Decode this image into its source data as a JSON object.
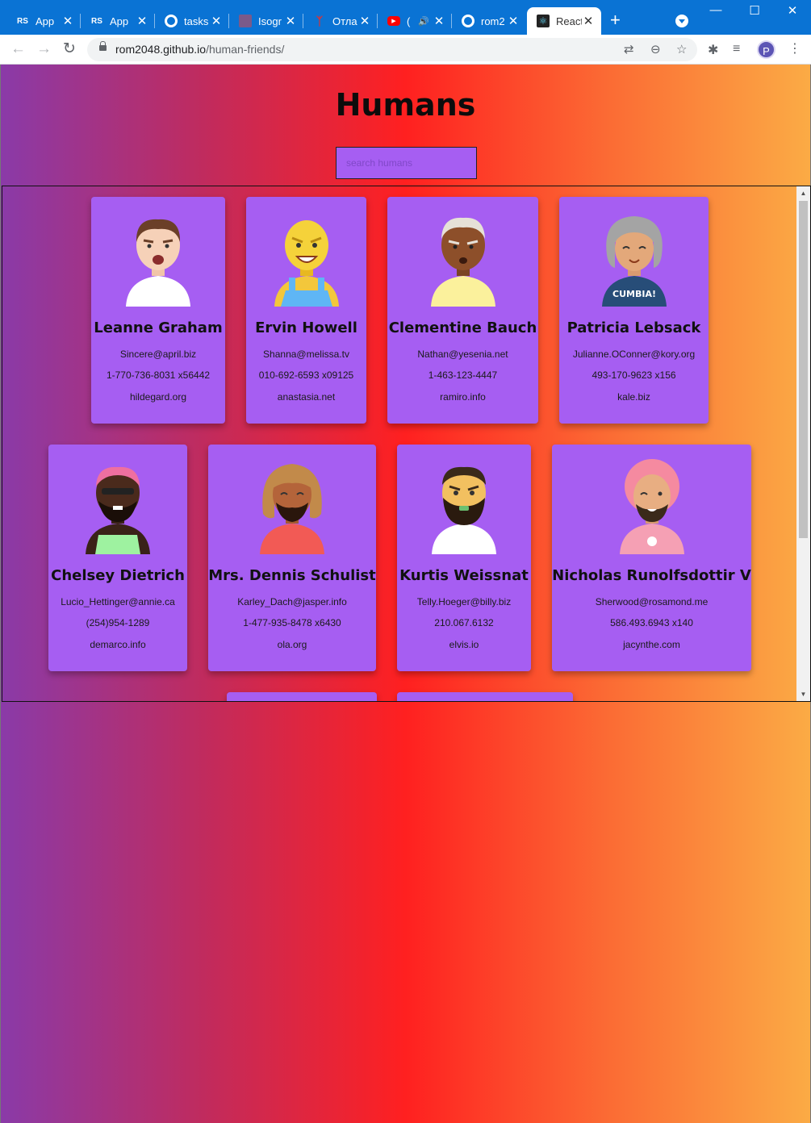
{
  "browser": {
    "tabs": [
      {
        "title": "App",
        "favicon": "RS",
        "favicon_bg": "#ffffff",
        "favicon_fg": "#222222"
      },
      {
        "title": "App",
        "favicon": "RS",
        "favicon_bg": "#ffffff",
        "favicon_fg": "#222222"
      },
      {
        "title": "tasks",
        "favicon": "github-icon",
        "favicon_bg": "#ffffff",
        "favicon_fg": "#000000"
      },
      {
        "title": "Isogr",
        "favicon": "isograph-icon",
        "favicon_bg": "#7a5a8a",
        "favicon_fg": "#ffffff"
      },
      {
        "title": "Отла",
        "favicon": "debug-icon",
        "favicon_bg": "#0a73d4",
        "favicon_fg": "#e03030"
      },
      {
        "title": "(",
        "favicon": "youtube-icon",
        "favicon_bg": "#ff0000",
        "favicon_fg": "#ffffff"
      },
      {
        "title": "rom2",
        "favicon": "github-icon",
        "favicon_bg": "#ffffff",
        "favicon_fg": "#000000"
      },
      {
        "title": "React",
        "favicon": "react-icon",
        "favicon_bg": "#222222",
        "favicon_fg": "#61dafb"
      }
    ],
    "url_host": "rom2048.github.io",
    "url_path": "/human-friends/"
  },
  "page": {
    "title": "Humans",
    "search_placeholder": "search humans"
  },
  "humans": [
    {
      "name": "Leanne Graham",
      "email": "Sincere@april.biz",
      "phone": "1-770-736-8031 x56442",
      "website": "hildegard.org"
    },
    {
      "name": "Ervin Howell",
      "email": "Shanna@melissa.tv",
      "phone": "010-692-6593 x09125",
      "website": "anastasia.net"
    },
    {
      "name": "Clementine Bauch",
      "email": "Nathan@yesenia.net",
      "phone": "1-463-123-4447",
      "website": "ramiro.info"
    },
    {
      "name": "Patricia Lebsack",
      "email": "Julianne.OConner@kory.org",
      "phone": "493-170-9623 x156",
      "website": "kale.biz",
      "shirt_text": "CUMBIA!"
    },
    {
      "name": "Chelsey Dietrich",
      "email": "Lucio_Hettinger@annie.ca",
      "phone": "(254)954-1289",
      "website": "demarco.info"
    },
    {
      "name": "Mrs. Dennis Schulist",
      "email": "Karley_Dach@jasper.info",
      "phone": "1-477-935-8478 x6430",
      "website": "ola.org"
    },
    {
      "name": "Kurtis Weissnat",
      "email": "Telly.Hoeger@billy.biz",
      "phone": "210.067.6132",
      "website": "elvis.io"
    },
    {
      "name": "Nicholas Runolfsdottir V",
      "email": "Sherwood@rosamond.me",
      "phone": "586.493.6943 x140",
      "website": "jacynthe.com"
    }
  ],
  "colors": {
    "card": "#a65ef2",
    "chrome_tabstrip": "#0a73d4",
    "gradient": [
      "#8a3aa8",
      "#c02b5e",
      "#ff2020",
      "#fb6b34",
      "#fbab45"
    ]
  }
}
